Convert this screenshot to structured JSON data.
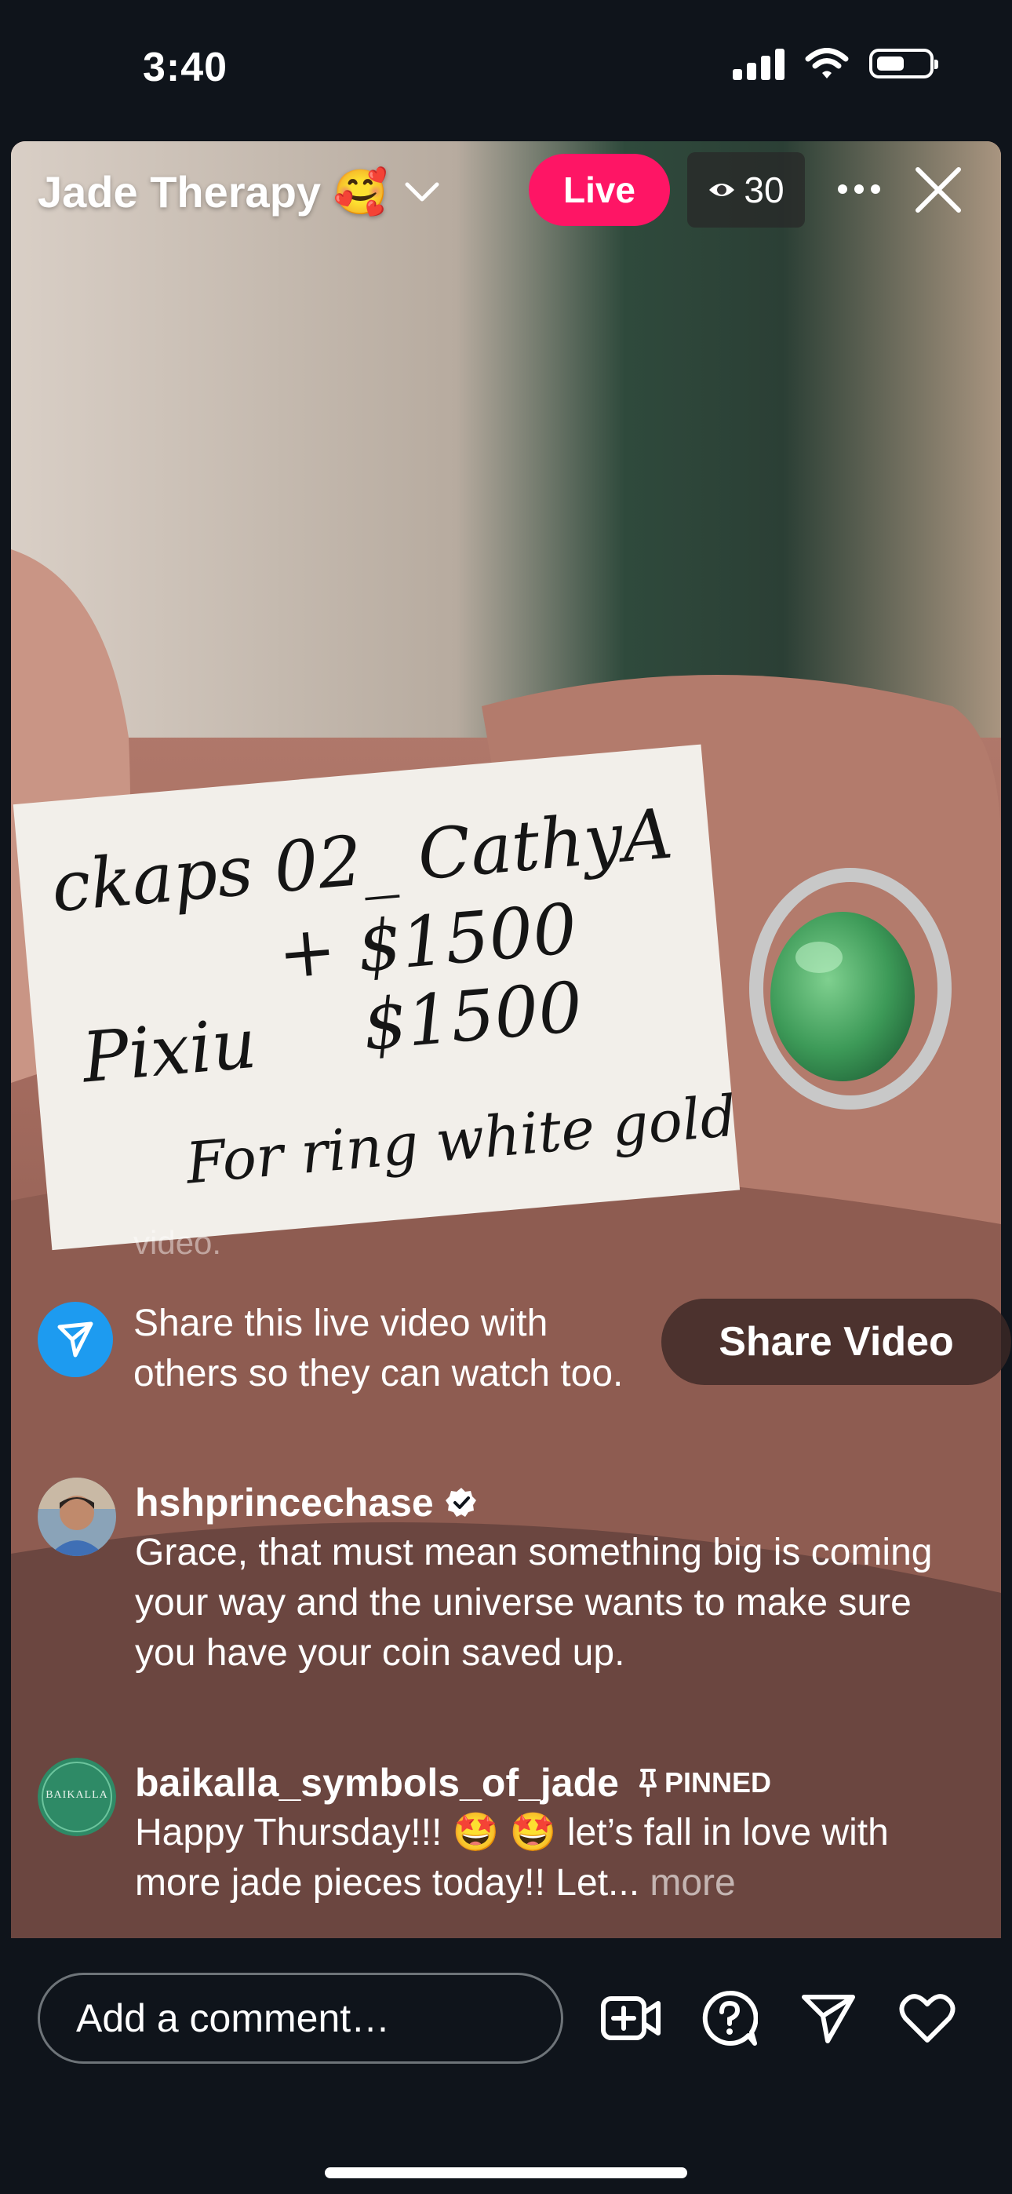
{
  "status_bar": {
    "time": "3:40"
  },
  "live_header": {
    "channel_name": "Jade Therapy 🥰",
    "live_label": "Live",
    "viewer_count": "30"
  },
  "video": {
    "card_lines": [
      "ckaps 02_ CathyA",
      "+ $1500",
      "Pixiu  $1500",
      "For ring white gold"
    ]
  },
  "feed": {
    "faded_text": "video.",
    "share_prompt": "Share this live video with others so they can watch too.",
    "share_button_label": "Share Video",
    "comments": [
      {
        "username": "hshprincechase",
        "verified": true,
        "text": "Grace, that must mean something big is coming your way and the universe wants to make sure you have your coin saved up."
      },
      {
        "username": "baikalla_symbols_of_jade",
        "pinned_label": "PINNED",
        "text": "Happy Thursday!!! 🤩 🤩 let’s fall in love with more jade pieces today!! Let...",
        "more_label": "more",
        "avatar_text": "BAIKALLA"
      }
    ]
  },
  "bottom_bar": {
    "comment_placeholder": "Add a comment…",
    "icons": [
      "add-video-icon",
      "question-icon",
      "send-icon",
      "heart-icon"
    ]
  },
  "colors": {
    "live_pink": "#fe1565",
    "share_blue": "#1d9bf0",
    "background": "#0f141b"
  }
}
